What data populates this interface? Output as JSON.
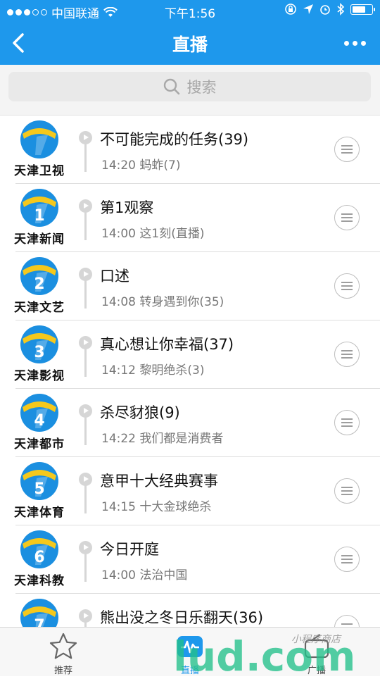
{
  "status_bar": {
    "carrier": "中国联通",
    "time": "下午1:56",
    "battery_level": 0.7
  },
  "nav": {
    "title": "直播",
    "back_icon": "chevron-left-icon",
    "more_icon": "more-horizontal-icon"
  },
  "search": {
    "placeholder": "搜索",
    "icon": "search-icon"
  },
  "channels": [
    {
      "name": "天津卫视",
      "num": "",
      "now": "不可能完成的任务(39)",
      "next": "14:20  蚂蚱(7)"
    },
    {
      "name": "天津新闻",
      "num": "1",
      "now": "第1观察",
      "next": "14:00  这1刻(直播)"
    },
    {
      "name": "天津文艺",
      "num": "2",
      "now": "口述",
      "next": "14:08  转身遇到你(35)"
    },
    {
      "name": "天津影视",
      "num": "3",
      "now": "真心想让你幸福(37)",
      "next": "14:12  黎明绝杀(3)"
    },
    {
      "name": "天津都市",
      "num": "4",
      "now": "杀尽豺狼(9)",
      "next": "14:22  我们都是消费者"
    },
    {
      "name": "天津体育",
      "num": "5",
      "now": "意甲十大经典赛事",
      "next": "14:15  十大金球绝杀"
    },
    {
      "name": "天津科教",
      "num": "6",
      "now": "今日开庭",
      "next": "14:00  法治中国"
    },
    {
      "name": "",
      "num": "7",
      "now": "熊出没之冬日乐翻天(36)",
      "next": ""
    }
  ],
  "tabbar": {
    "tabs": [
      {
        "label": "推荐",
        "icon": "star-icon"
      },
      {
        "label": "直播",
        "icon": "live-tv-icon"
      },
      {
        "label": "广播",
        "icon": "radio-icon"
      }
    ]
  },
  "watermark": {
    "text": "lud.com",
    "sub": "小程序商店"
  },
  "colors": {
    "brand_blue": "#1e98ec",
    "logo_blue": "#1b8fe0",
    "logo_yellow": "#f5c81c"
  }
}
